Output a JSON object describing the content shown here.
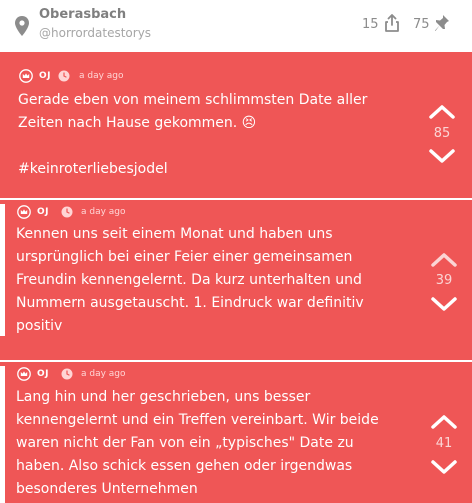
{
  "header": {
    "channel": "Oberasbach",
    "handle": "@horrordatestorys",
    "share_count": "15",
    "pin_count": "75"
  },
  "posts": [
    {
      "author": "OJ",
      "time": "a day ago",
      "lines": [
        "Gerade eben von meinem schlimmsten Date aller",
        "Zeiten nach Hause gekommen. 😣",
        "",
        "#keinroterliebesjodel"
      ],
      "votes": "85"
    },
    {
      "author": "OJ",
      "time": "a day ago",
      "lines": [
        "Kennen uns seit einem Monat und haben uns",
        "ursprünglich bei einer Feier einer gemeinsamen",
        "Freundin kennengelernt. Da kurz unterhalten und",
        "Nummern ausgetauscht. 1. Eindruck war definitiv",
        "positiv"
      ],
      "votes": "39"
    },
    {
      "author": "OJ",
      "time": "a day ago",
      "lines": [
        "Lang hin und her geschrieben, uns besser",
        "kennengelernt und ein Treffen vereinbart. Wir beide",
        "waren nicht der Fan von ein „typisches\" Date zu",
        "haben. Also schick essen gehen oder irgendwas",
        "besonderes Unternehmen"
      ],
      "votes": "41"
    }
  ],
  "colors": {
    "post_background": "#ef5656",
    "header_text": "#7f7f7f",
    "white": "#ffffff"
  }
}
